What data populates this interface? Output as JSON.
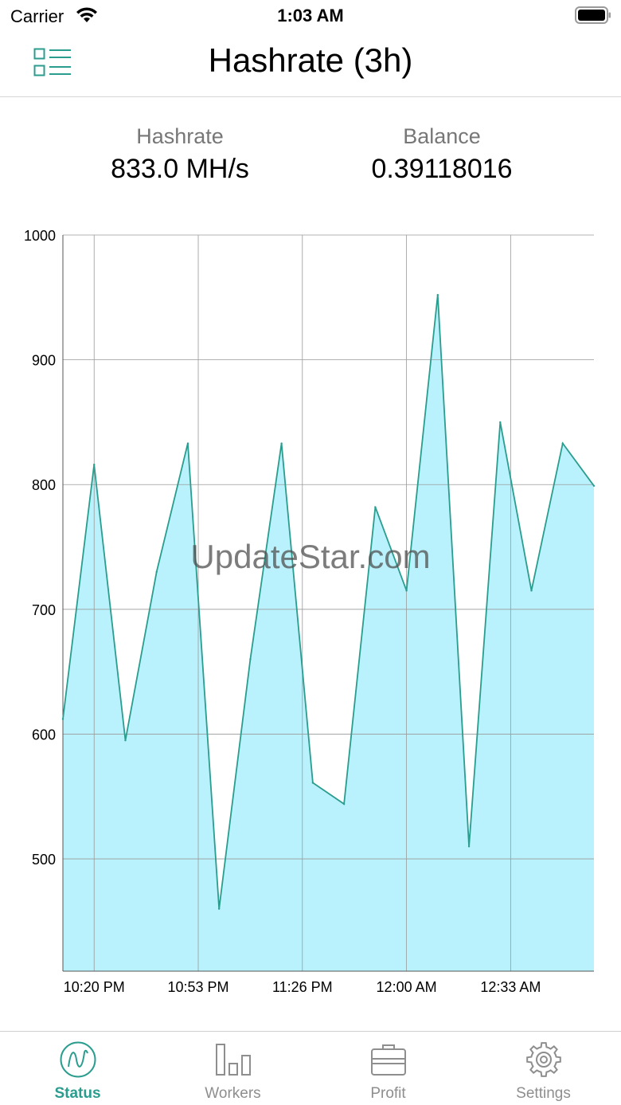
{
  "status_bar": {
    "carrier": "Carrier",
    "time": "1:03 AM"
  },
  "nav": {
    "title": "Hashrate (3h)",
    "menu_icon": "list-icon"
  },
  "stats": {
    "hashrate_label": "Hashrate",
    "hashrate_value": "833.0 MH/s",
    "balance_label": "Balance",
    "balance_value": "0.39118016"
  },
  "watermark": "UpdateStar.com",
  "colors": {
    "accent": "#2a9d8f",
    "fill": "#b9f2fc",
    "line": "#2a9d8f",
    "inactive": "#8e8e8e"
  },
  "chart_data": {
    "type": "area",
    "title": "",
    "xlabel": "",
    "ylabel": "",
    "ylim": [
      410,
      1000
    ],
    "y_ticks": [
      500,
      600,
      700,
      800,
      900,
      1000
    ],
    "x_ticks": [
      "10:20 PM",
      "10:53 PM",
      "11:26 PM",
      "12:00 AM",
      "12:33 AM"
    ],
    "grid": true,
    "values": [
      612,
      816,
      595,
      730,
      833,
      460,
      660,
      833,
      561,
      544,
      782,
      715,
      952,
      510,
      850,
      715,
      833,
      799
    ]
  },
  "tabs": [
    {
      "label": "Status",
      "icon": "status-wave-icon",
      "active": true
    },
    {
      "label": "Workers",
      "icon": "workers-bars-icon",
      "active": false
    },
    {
      "label": "Profit",
      "icon": "briefcase-icon",
      "active": false
    },
    {
      "label": "Settings",
      "icon": "gear-icon",
      "active": false
    }
  ]
}
